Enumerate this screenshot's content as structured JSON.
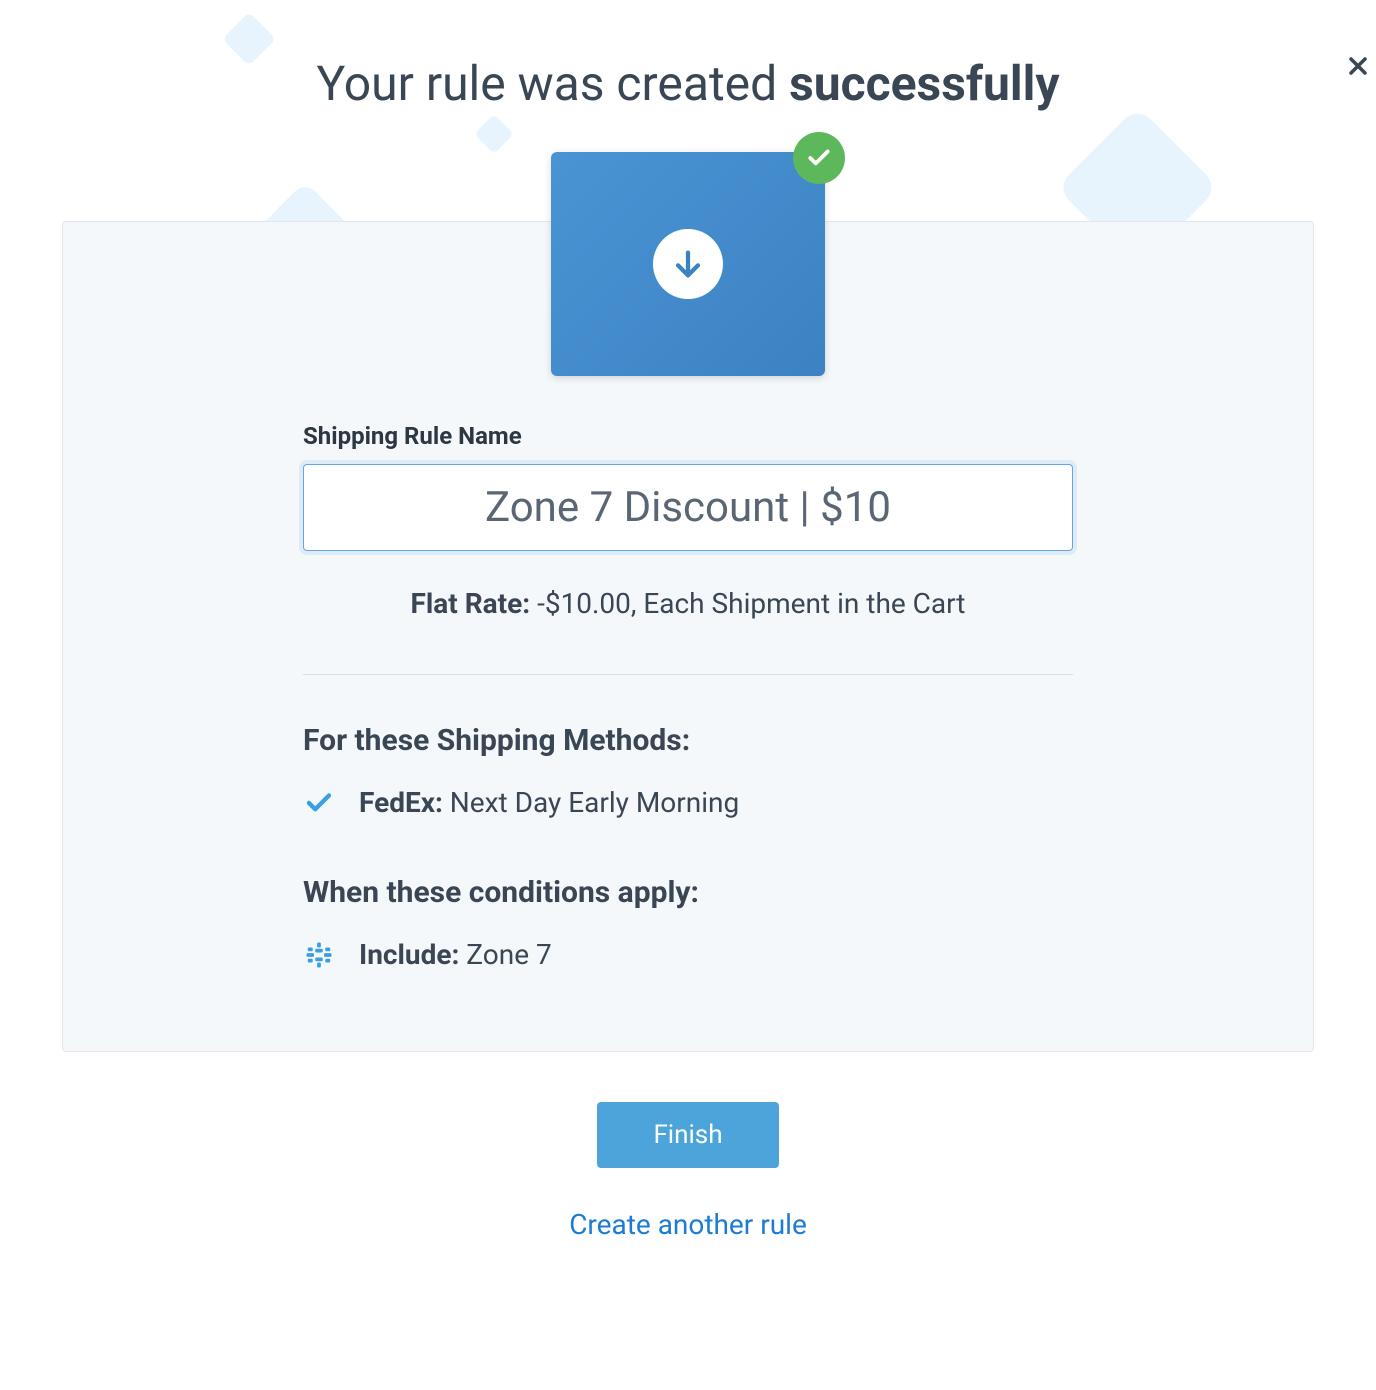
{
  "title": {
    "prefix": "Your rule was created ",
    "emphasis": "successfully"
  },
  "form": {
    "name_label": "Shipping Rule Name",
    "name_value": "Zone 7 Discount | $10"
  },
  "rate": {
    "label": "Flat Rate: ",
    "value": "-$10.00, Each Shipment in the Cart"
  },
  "methods": {
    "heading": "For these Shipping Methods:",
    "items": [
      {
        "carrier": "FedEx:",
        "service": " Next Day Early Morning"
      }
    ]
  },
  "conditions": {
    "heading": "When these conditions apply:",
    "items": [
      {
        "prefix": "Include:",
        "value": " Zone 7"
      }
    ]
  },
  "actions": {
    "finish_label": "Finish",
    "create_another_label": "Create another rule"
  }
}
